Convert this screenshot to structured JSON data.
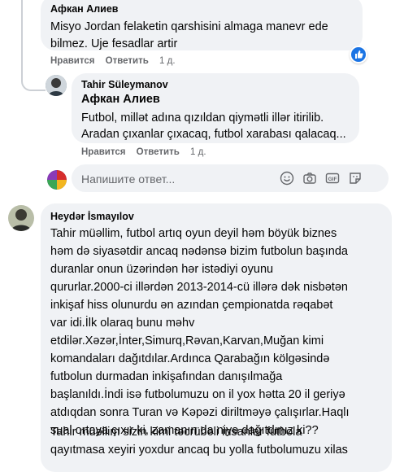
{
  "comment1": {
    "author": "Афкан Алиев",
    "lines": [
      "Misyo Jordan felaketin qarshisini almaga manevr ede",
      "bilmez. Uje fesadlar artir"
    ],
    "like": "Нравится",
    "reply": "Ответить",
    "time": "1 д."
  },
  "reply1": {
    "author": "Tahir Süleymanov",
    "mention": "Афкан Алиев",
    "lines": [
      "Futbol, millət adına qızıldan qiymətli illər itirilib.",
      "Aradan çıxanlar çıxacaq, futbol xarabası qalacaq..."
    ],
    "like": "Нравится",
    "reply": "Ответить",
    "time": "1 д."
  },
  "reply_input": {
    "placeholder": "Напишите ответ..."
  },
  "comment2": {
    "author": "Heydər İsmayılov",
    "lines": [
      "Tahir müəllim, futbol artıq oyun deyil həm böyük biznes",
      "həm də siyasətdir ancaq nədənsə bizim futbolun başında",
      "duranlar onun üzərindən hər istədiyi oyunu",
      "qururlar.2000-ci illərdən 2013-2014-cü illərə dək nisbətən",
      "inkişaf hiss olunurdu ən azından çempionatda rəqabət",
      "var idi.İlk olaraq bunu məhv",
      "etdilər.Xəzər,İnter,Simurq,Rəvan,Karvan,Muğan kimi",
      "komandaları dağıtdılar.Ardınca Qarabağın kölgəsində",
      "futbolun durmadan inkişafından danışılmağa",
      "başlanıldı.İndi isə futbolumuzu on il yox hətta 20 il geriyə",
      "atdıqdan sonra Turan və Kəpəzi diriltməyə çalışırlar.Haqlı",
      "sual ortaya çıxır ki, zamanın da niyə dağıtdınız ki??"
    ],
    "line_last": [
      "Tahir müəllim sizin kimi təcrübəli insanlar futbola",
      "qayıtmasa xeyiri yoxdur ancaq bu yolla futbolumuzu xilas"
    ]
  },
  "icons": [
    "like-icon",
    "emoji-icon",
    "camera-icon",
    "gif-icon",
    "sticker-icon"
  ],
  "colors": {
    "like_blue": "#1b74e4",
    "text_secondary": "#65676b",
    "bubble_bg": "#f0f2f5"
  }
}
